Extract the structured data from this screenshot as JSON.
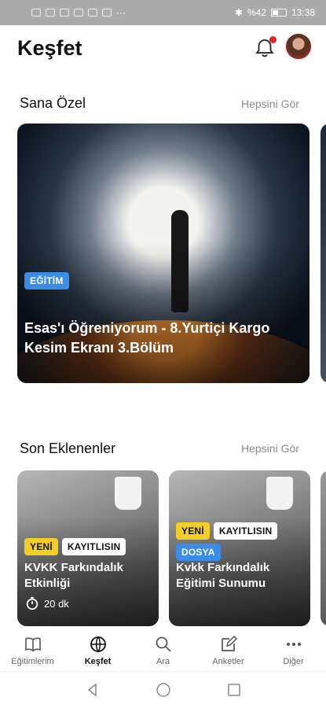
{
  "status_bar": {
    "battery_text": "%42",
    "time": "13:38",
    "battery_level": 0.42
  },
  "header": {
    "title": "Keşfet",
    "has_notification": true
  },
  "sections": {
    "for_you": {
      "title": "Sana Özel",
      "see_all": "Hepsini Gör",
      "featured": {
        "badge": "EĞİTİM",
        "title": "Esas'ı Öğreniyorum - 8.Yurtiçi Kargo Kesim Ekranı 3.Bölüm"
      }
    },
    "recent": {
      "title": "Son Eklenenler",
      "see_all": "Hepsini Gör",
      "cards": [
        {
          "badges": [
            "YENİ",
            "KAYITLISIN"
          ],
          "title": "KVKK Farkındalık Etkinliği",
          "duration": "20 dk"
        },
        {
          "badges": [
            "YENİ",
            "KAYITLISIN",
            "DOSYA"
          ],
          "title": "Kvkk Farkındalık Eğitimi Sunumu"
        }
      ]
    }
  },
  "tabs": [
    {
      "label": "Eğitimlerim",
      "icon": "book-icon"
    },
    {
      "label": "Keşfet",
      "icon": "globe-icon",
      "active": true
    },
    {
      "label": "Ara",
      "icon": "search-icon"
    },
    {
      "label": "Anketler",
      "icon": "edit-icon"
    },
    {
      "label": "Diğer",
      "icon": "more-icon"
    }
  ],
  "colors": {
    "accent_blue": "#3b8ce6",
    "badge_yellow": "#f1cf27",
    "notification_red": "#e42620"
  }
}
